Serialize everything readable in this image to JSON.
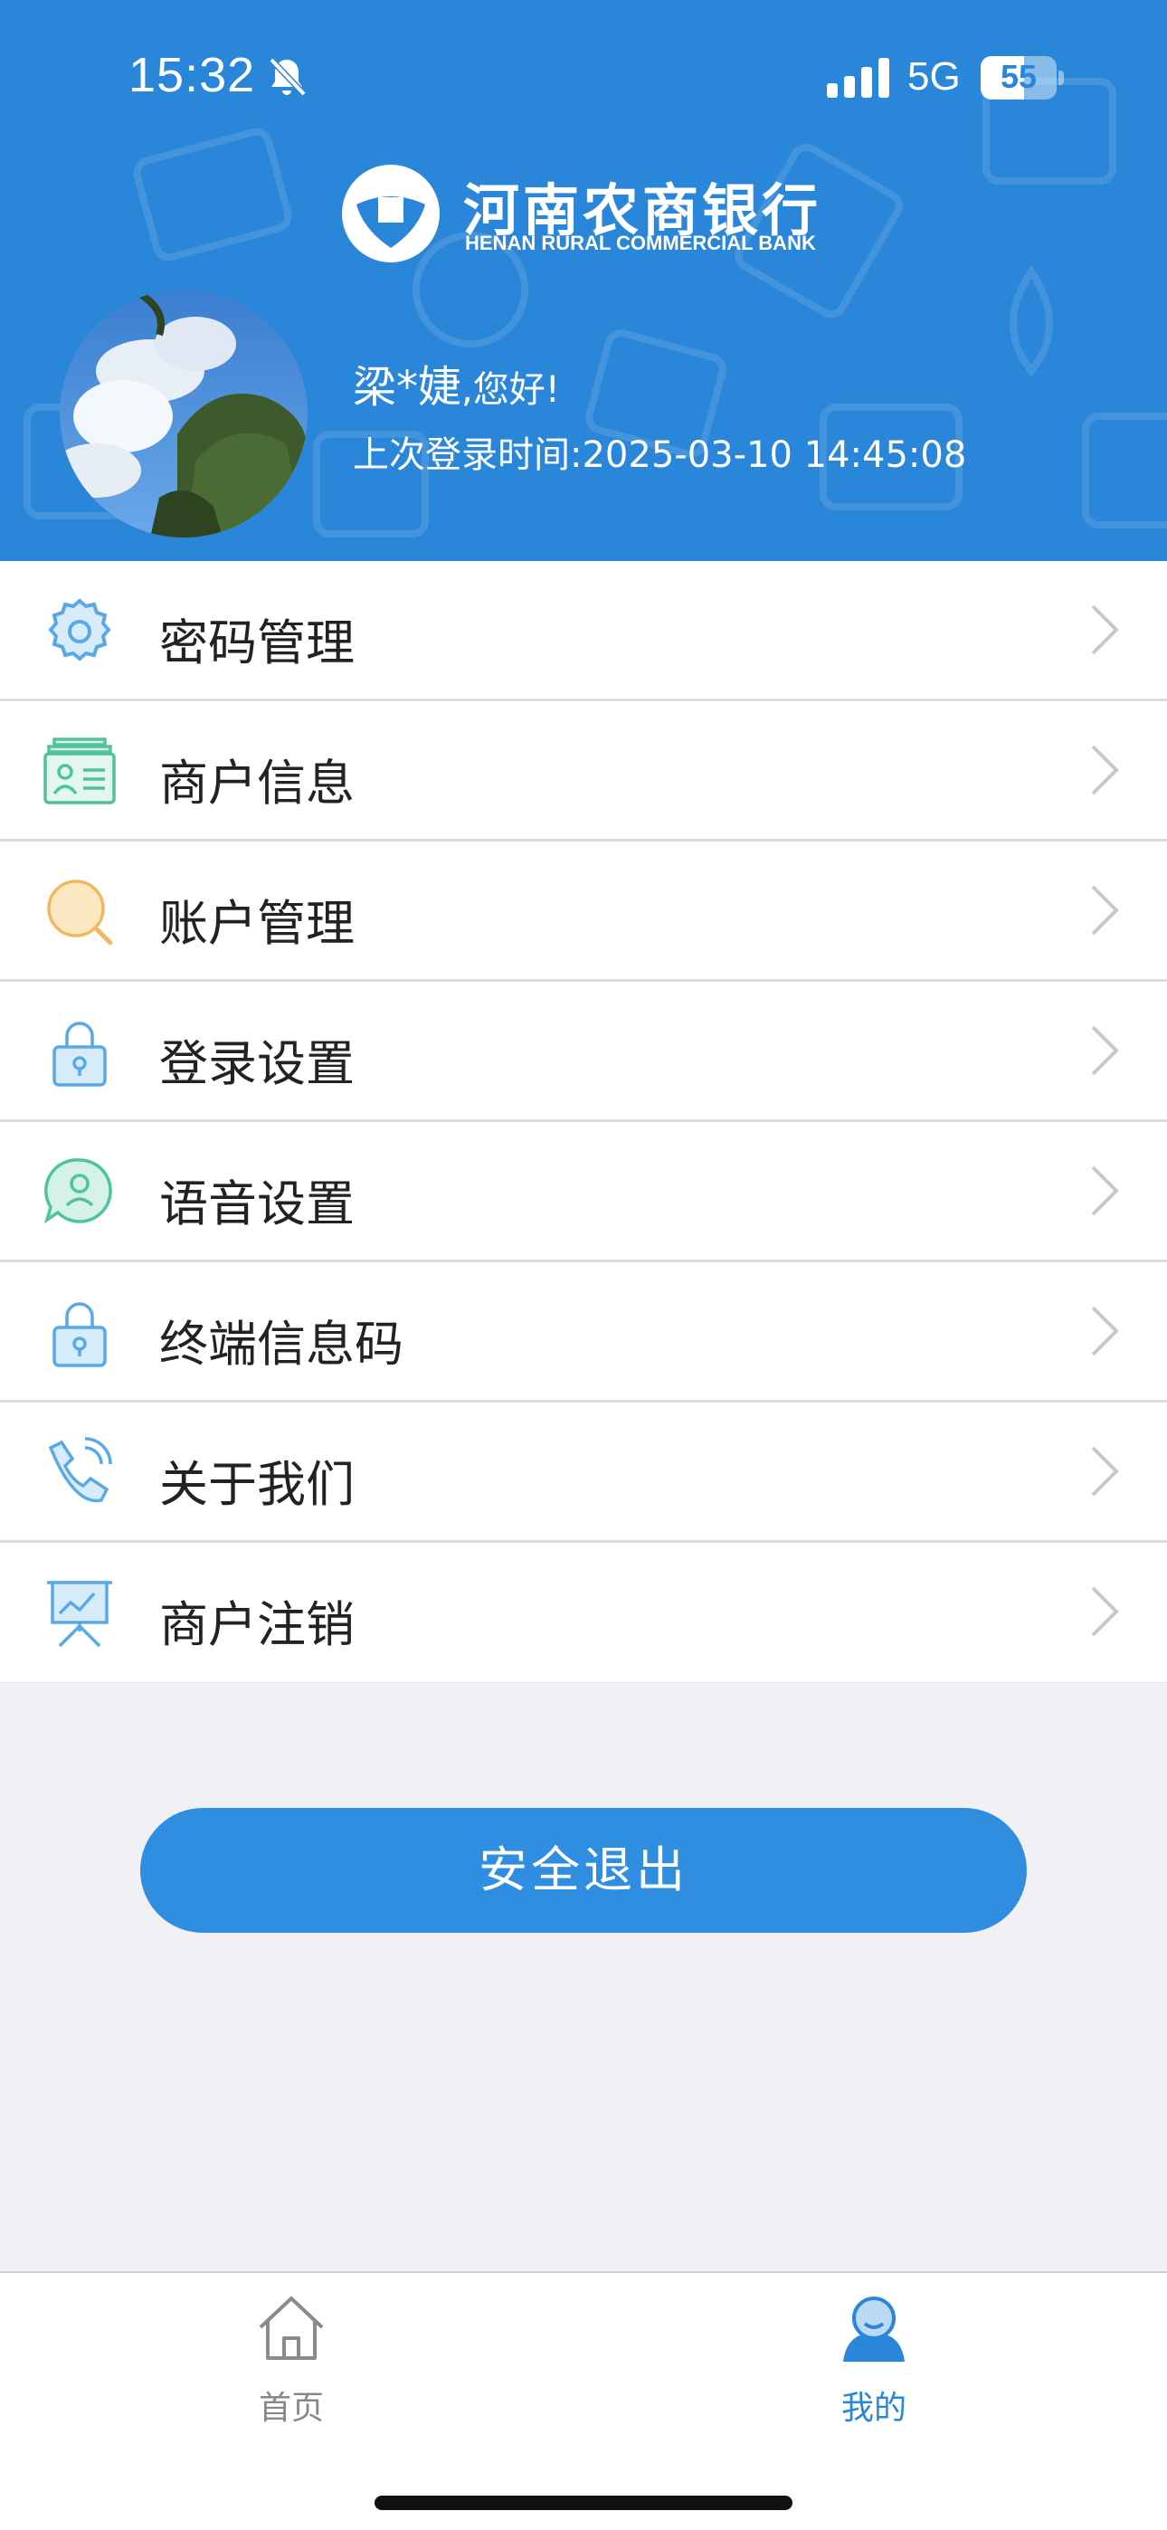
{
  "status_bar": {
    "time": "15:32",
    "network": "5G",
    "battery": "55",
    "icons": [
      "bell-slash-icon",
      "signal-icon",
      "battery-icon"
    ]
  },
  "brand": {
    "name_cn": "河南农商银行",
    "name_en": "HENAN RURAL COMMERCIAL BANK"
  },
  "profile": {
    "name": "梁*婕",
    "greeting_suffix": ",您好!",
    "last_login": "上次登录时间:2025-03-10 14:45:08"
  },
  "menu": {
    "items": [
      {
        "label": "密码管理",
        "icon": "gear-icon"
      },
      {
        "label": "商户信息",
        "icon": "id-card-icon"
      },
      {
        "label": "账户管理",
        "icon": "magnifier-icon"
      },
      {
        "label": "登录设置",
        "icon": "lock-icon"
      },
      {
        "label": "语音设置",
        "icon": "chat-user-icon"
      },
      {
        "label": "终端信息码",
        "icon": "lock-icon"
      },
      {
        "label": "关于我们",
        "icon": "phone-icon"
      },
      {
        "label": "商户注销",
        "icon": "presentation-board-icon"
      }
    ]
  },
  "logout": {
    "label": "安全退出"
  },
  "tabbar": {
    "tabs": [
      {
        "label": "首页",
        "icon": "home-icon",
        "active": false
      },
      {
        "label": "我的",
        "icon": "user-icon",
        "active": true
      }
    ]
  },
  "colors": {
    "primary": "#2a86d8",
    "button": "#2f8ee0",
    "background": "#f0f0f5"
  }
}
